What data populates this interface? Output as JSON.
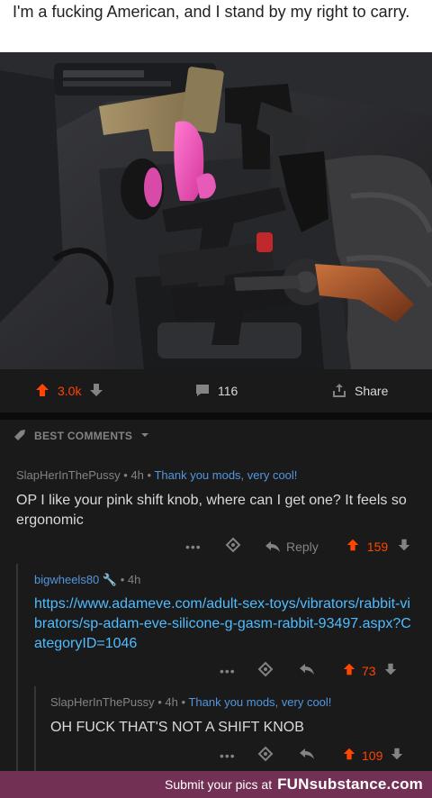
{
  "post": {
    "title": "I'm a fucking American, and I stand by my right to carry."
  },
  "actions": {
    "upvotes": "3.0k",
    "comments": "116",
    "share_label": "Share"
  },
  "comments_header": {
    "label": "BEST COMMENTS"
  },
  "comments": [
    {
      "author": "SlapHerInThePussy",
      "age": "4h",
      "flair": "Thank you mods, very cool!",
      "text": "OP I like your pink shift knob, where can I get one? It feels so ergonomic",
      "reply_label": "Reply",
      "score": "159"
    },
    {
      "author": "bigwheels80",
      "age": "4h",
      "text": "https://www.adameve.com/adult-sex-toys/vibrators/rabbit-vibrators/sp-adam-eve-silicone-g-gasm-rabbit-93497.aspx?CategoryID=1046",
      "score": "73"
    },
    {
      "author": "SlapHerInThePussy",
      "age": "4h",
      "flair": "Thank you mods, very cool!",
      "text": "OH FUCK THAT'S NOT A SHIFT KNOB",
      "score": "109"
    }
  ],
  "footer": {
    "text": "Submit your pics at",
    "brand": "FUNsubstance.com"
  },
  "colors": {
    "upvote": "#ff4500",
    "link": "#4fbcff",
    "flair": "#5296dd",
    "footer_bg": "#733055"
  },
  "icons": [
    "upvote-arrow-icon",
    "downvote-arrow-icon",
    "comment-bubble-icon",
    "share-icon",
    "rocket-icon",
    "chevron-down-icon",
    "more-dots-icon",
    "award-icon",
    "reply-arrow-icon",
    "wrench-icon"
  ]
}
